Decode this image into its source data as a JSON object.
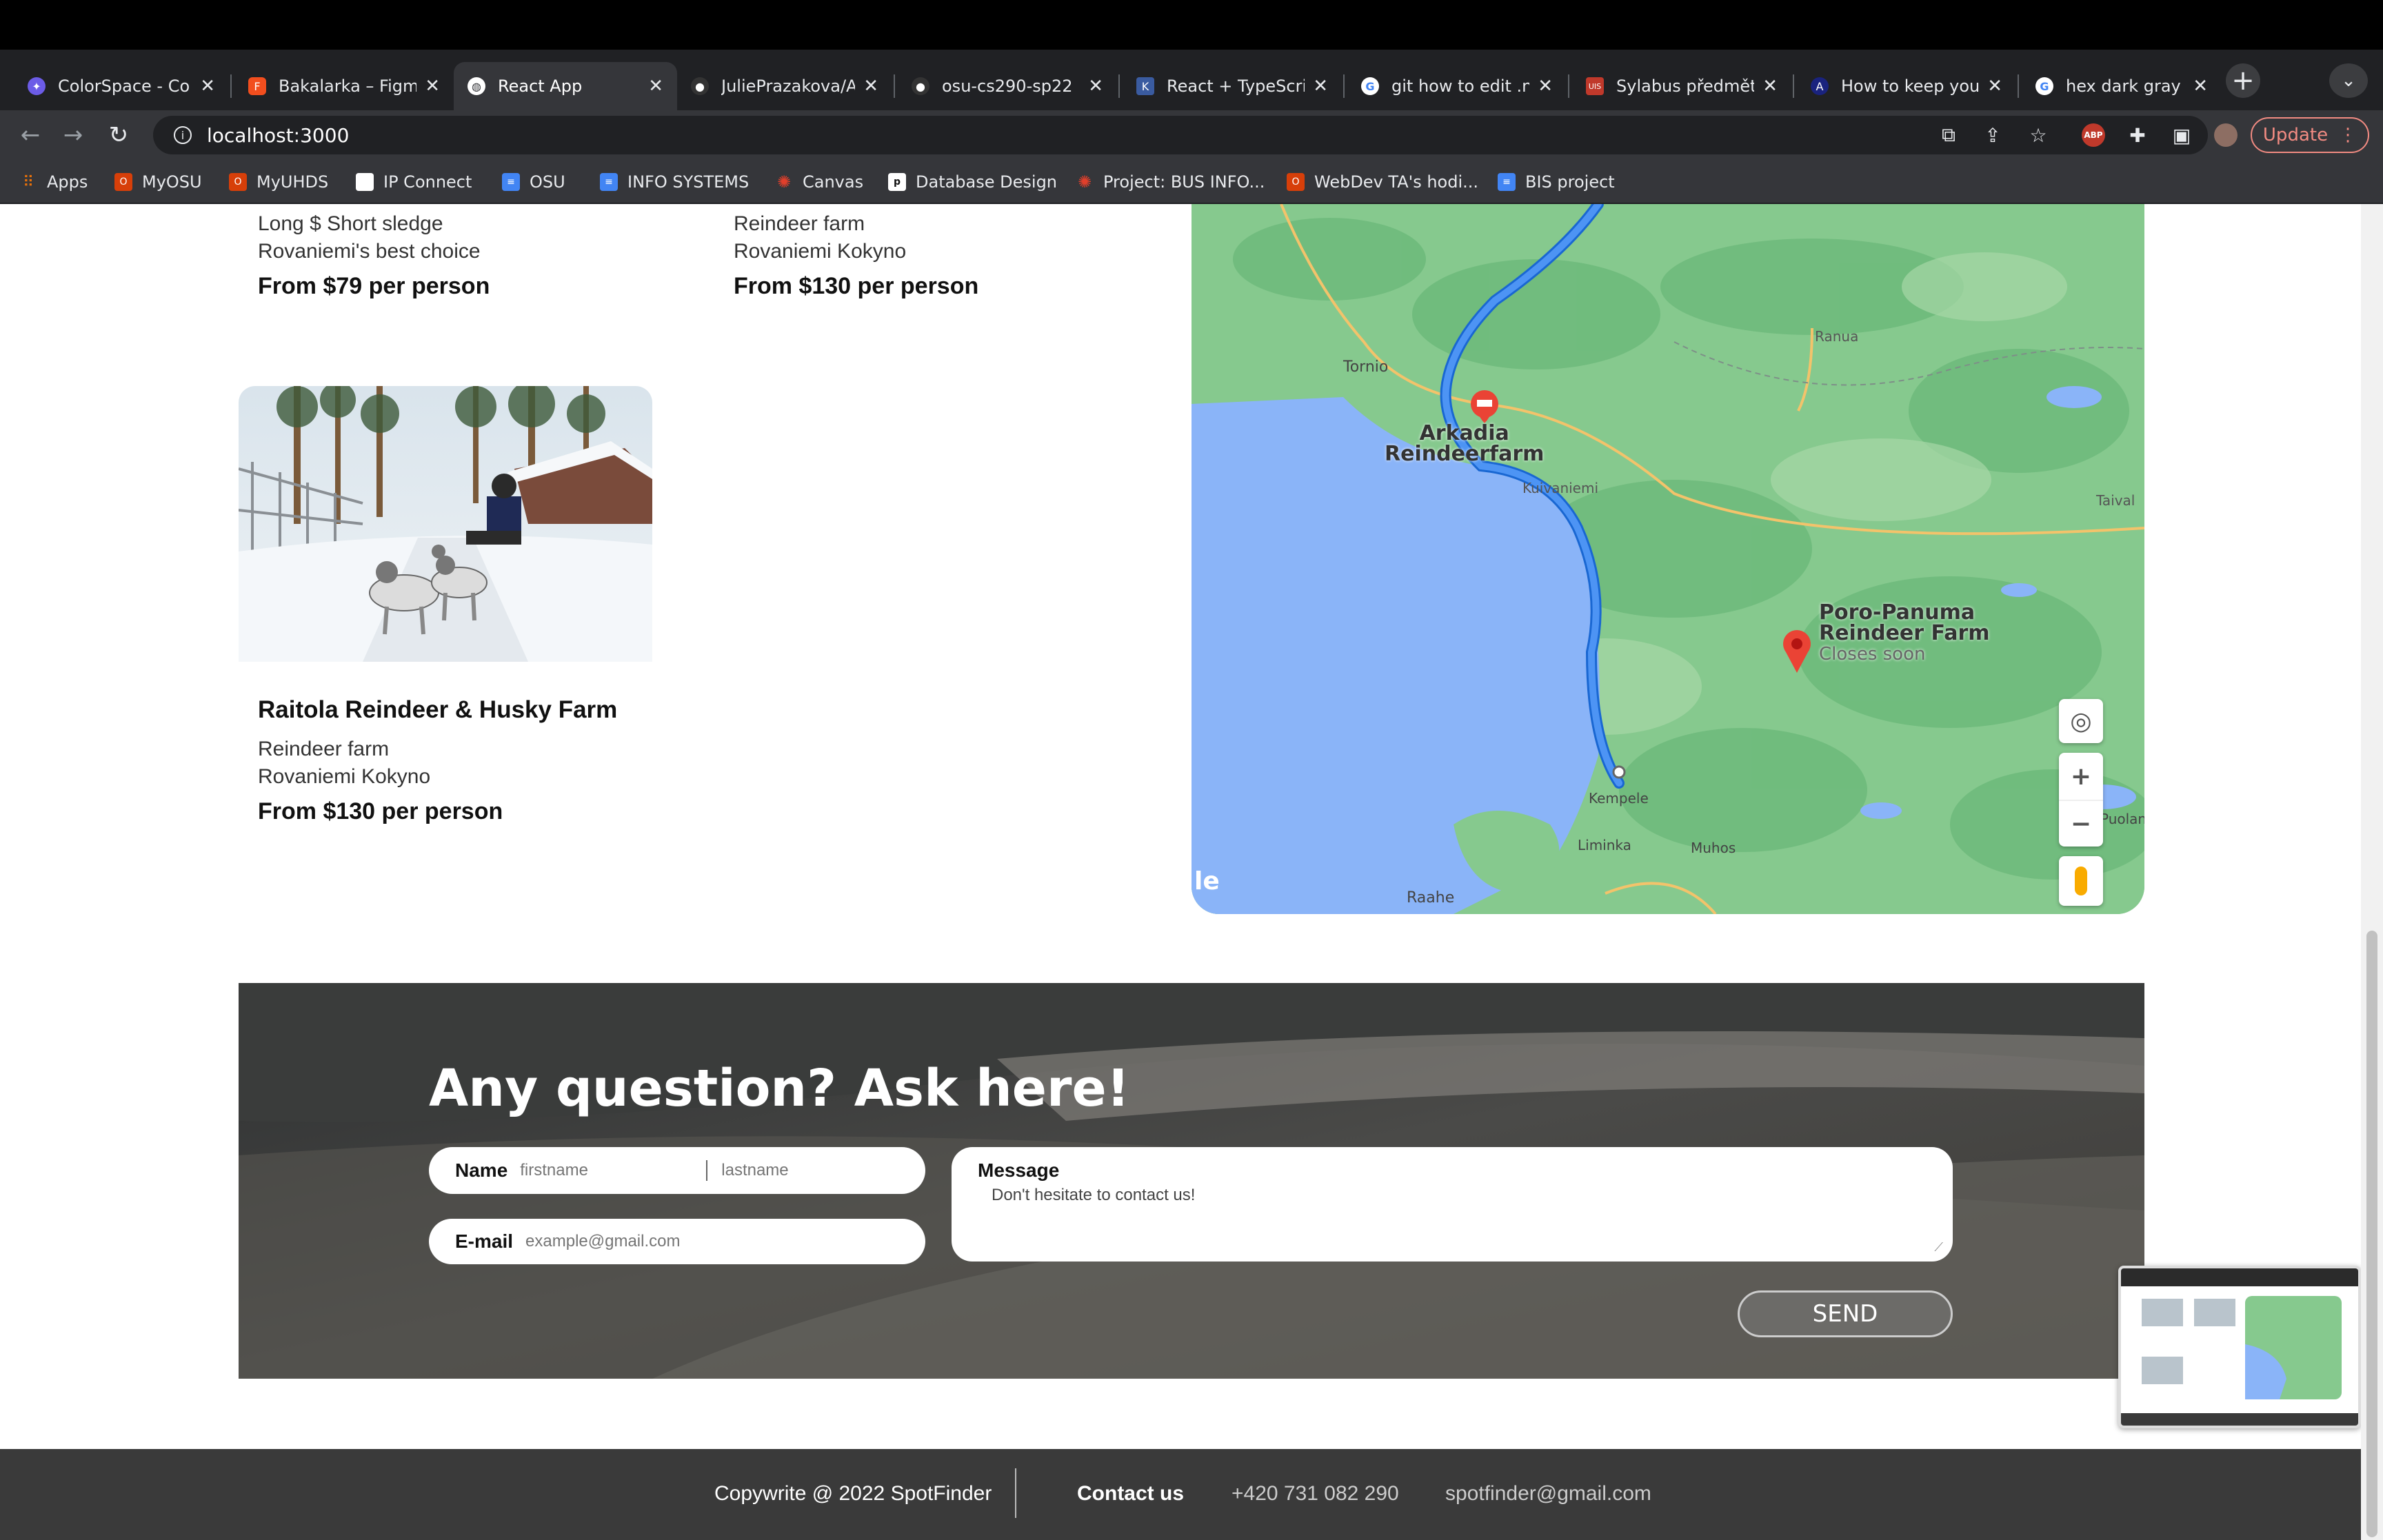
{
  "browser": {
    "tabs": [
      {
        "label": "ColorSpace - Co",
        "icon": "colorspace-icon",
        "color": "#6c5ce7"
      },
      {
        "label": "Bakalarka – Figm",
        "icon": "figma-icon",
        "color": "#f24e1e"
      },
      {
        "label": "React App",
        "icon": "globe-icon",
        "color": "#ffffff",
        "active": true
      },
      {
        "label": "JuliePrazakova/A",
        "icon": "github-icon",
        "color": "#333333"
      },
      {
        "label": "osu-cs290-sp22",
        "icon": "github-icon",
        "color": "#333333"
      },
      {
        "label": "React + TypeScri",
        "icon": "k-icon",
        "color": "#3a5ba0"
      },
      {
        "label": "git how to edit .n",
        "icon": "google-icon",
        "color": "#4285f4"
      },
      {
        "label": "Sylabus předmět",
        "icon": "uis-icon",
        "color": "#c0392b"
      },
      {
        "label": "How to keep you",
        "icon": "a-icon",
        "color": "#1a237e"
      },
      {
        "label": "hex dark gray – ",
        "icon": "google-icon",
        "color": "#4285f4"
      }
    ],
    "url": "localhost:3000",
    "update_label": "Update",
    "bookmarks": [
      {
        "label": "Apps",
        "icon": "apps-grid-icon",
        "color": "#e8710a"
      },
      {
        "label": "MyOSU",
        "icon": "osu-icon",
        "color": "#d73f09"
      },
      {
        "label": "MyUHDS",
        "icon": "osu-icon",
        "color": "#d73f09"
      },
      {
        "label": "IP Connect",
        "icon": "page-icon",
        "color": "#ffffff"
      },
      {
        "label": "OSU",
        "icon": "doc-icon",
        "color": "#4285f4"
      },
      {
        "label": "INFO SYSTEMS",
        "icon": "doc-icon",
        "color": "#4285f4"
      },
      {
        "label": "Canvas",
        "icon": "canvas-icon",
        "color": "#e13f2b"
      },
      {
        "label": "Database Design",
        "icon": "p-icon",
        "color": "#ffffff"
      },
      {
        "label": "Project: BUS INFO...",
        "icon": "canvas-icon",
        "color": "#e13f2b"
      },
      {
        "label": "WebDev TA's hodi...",
        "icon": "osu-icon",
        "color": "#d73f09"
      },
      {
        "label": "BIS project",
        "icon": "doc-icon",
        "color": "#4285f4"
      }
    ]
  },
  "cards": [
    {
      "type": "Long $ Short sledge",
      "location": "Rovaniemi's best choice",
      "price": "From $79 per person"
    },
    {
      "type": "Reindeer farm",
      "location": "Rovaniemi Kokyno",
      "price": "From $130 per person"
    },
    {
      "title": "Raitola Reindeer & Husky Farm",
      "type": "Reindeer farm",
      "location": "Rovaniemi Kokyno",
      "price": "From $130 per person"
    }
  ],
  "map": {
    "labels": {
      "tornio": "Tornio",
      "ranua": "Ranua",
      "arkadia_1": "Arkadia",
      "arkadia_2": "Reindeerfarm",
      "kuivaniemi": "Kuivaniemi",
      "taival": "Taival",
      "poro_1": "Poro-Panuma",
      "poro_2": "Reindeer Farm",
      "poro_3": "Closes soon",
      "kempele": "Kempele",
      "liminka": "Liminka",
      "muhos": "Muhos",
      "puolanka": "Puolank",
      "raahe": "Raahe",
      "google": "le"
    }
  },
  "contact": {
    "heading": "Any question? Ask here!",
    "name_label": "Name",
    "firstname_placeholder": "firstname",
    "lastname_placeholder": "lastname",
    "email_label": "E-mail",
    "email_placeholder": "example@gmail.com",
    "message_label": "Message",
    "message_placeholder": "Don't hesitate to contact us!",
    "send_label": "SEND"
  },
  "footer": {
    "copyright": "Copywrite @ 2022 SpotFinder",
    "contact_label": "Contact us",
    "phone": "+420 731 082 290",
    "email": "spotfinder@gmail.com"
  }
}
